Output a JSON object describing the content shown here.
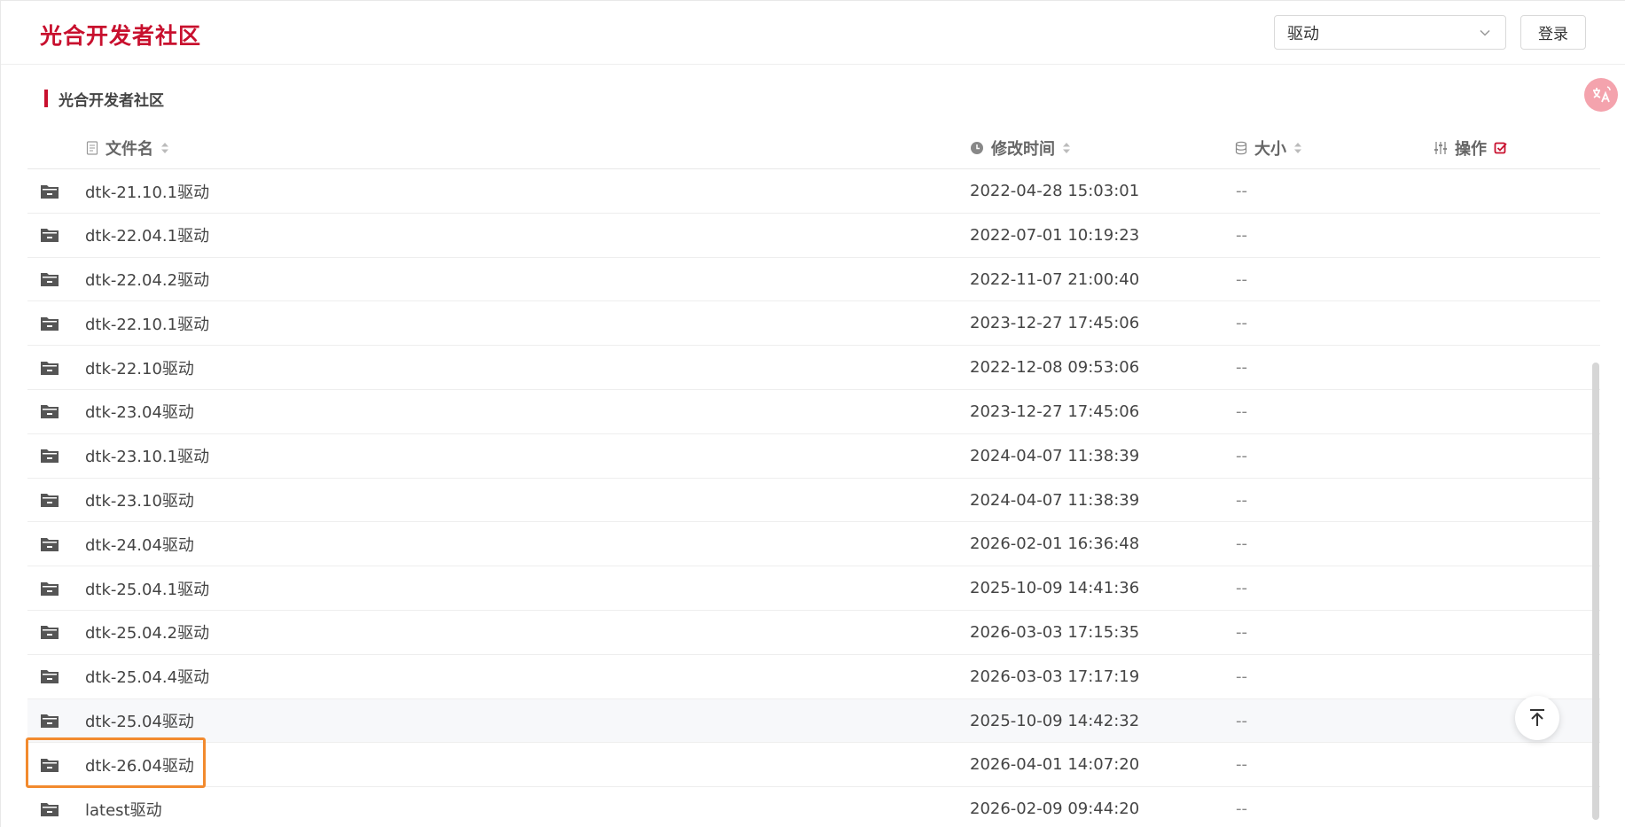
{
  "header": {
    "brand": "光合开发者社区",
    "search_value": "驱动",
    "login_label": "登录"
  },
  "breadcrumb": {
    "label": "光合开发者社区"
  },
  "table": {
    "columns": {
      "name": "文件名",
      "time": "修改时间",
      "size": "大小",
      "ops": "操作"
    },
    "rows": [
      {
        "name": "dtk-21.10.1驱动",
        "time": "2022-04-28 15:03:01",
        "size": "--"
      },
      {
        "name": "dtk-22.04.1驱动",
        "time": "2022-07-01 10:19:23",
        "size": "--"
      },
      {
        "name": "dtk-22.04.2驱动",
        "time": "2022-11-07 21:00:40",
        "size": "--"
      },
      {
        "name": "dtk-22.10.1驱动",
        "time": "2023-12-27 17:45:06",
        "size": "--"
      },
      {
        "name": "dtk-22.10驱动",
        "time": "2022-12-08 09:53:06",
        "size": "--"
      },
      {
        "name": "dtk-23.04驱动",
        "time": "2023-12-27 17:45:06",
        "size": "--"
      },
      {
        "name": "dtk-23.10.1驱动",
        "time": "2024-04-07 11:38:39",
        "size": "--"
      },
      {
        "name": "dtk-23.10驱动",
        "time": "2024-04-07 11:38:39",
        "size": "--"
      },
      {
        "name": "dtk-24.04驱动",
        "time": "2026-02-01 16:36:48",
        "size": "--"
      },
      {
        "name": "dtk-25.04.1驱动",
        "time": "2025-10-09 14:41:36",
        "size": "--"
      },
      {
        "name": "dtk-25.04.2驱动",
        "time": "2026-03-03 17:15:35",
        "size": "--"
      },
      {
        "name": "dtk-25.04.4驱动",
        "time": "2026-03-03 17:17:19",
        "size": "--"
      },
      {
        "name": "dtk-25.04驱动",
        "time": "2025-10-09 14:42:32",
        "size": "--"
      },
      {
        "name": "dtk-26.04驱动",
        "time": "2026-04-01 14:07:20",
        "size": "--"
      },
      {
        "name": "latest驱动",
        "time": "2026-02-09 09:44:20",
        "size": "--"
      }
    ]
  },
  "colors": {
    "brand": "#c8102e",
    "highlight": "#f28a2e",
    "hover_row": "#f7f8fa"
  },
  "icons": {
    "row": "folder-icon",
    "name_col": "file-icon",
    "time_col": "clock-icon",
    "size_col": "database-icon",
    "ops_col": "sliders-icon",
    "ops_extra": "checkbox-icon",
    "fab_translate": "translate-icon",
    "fab_top": "back-to-top-icon"
  }
}
